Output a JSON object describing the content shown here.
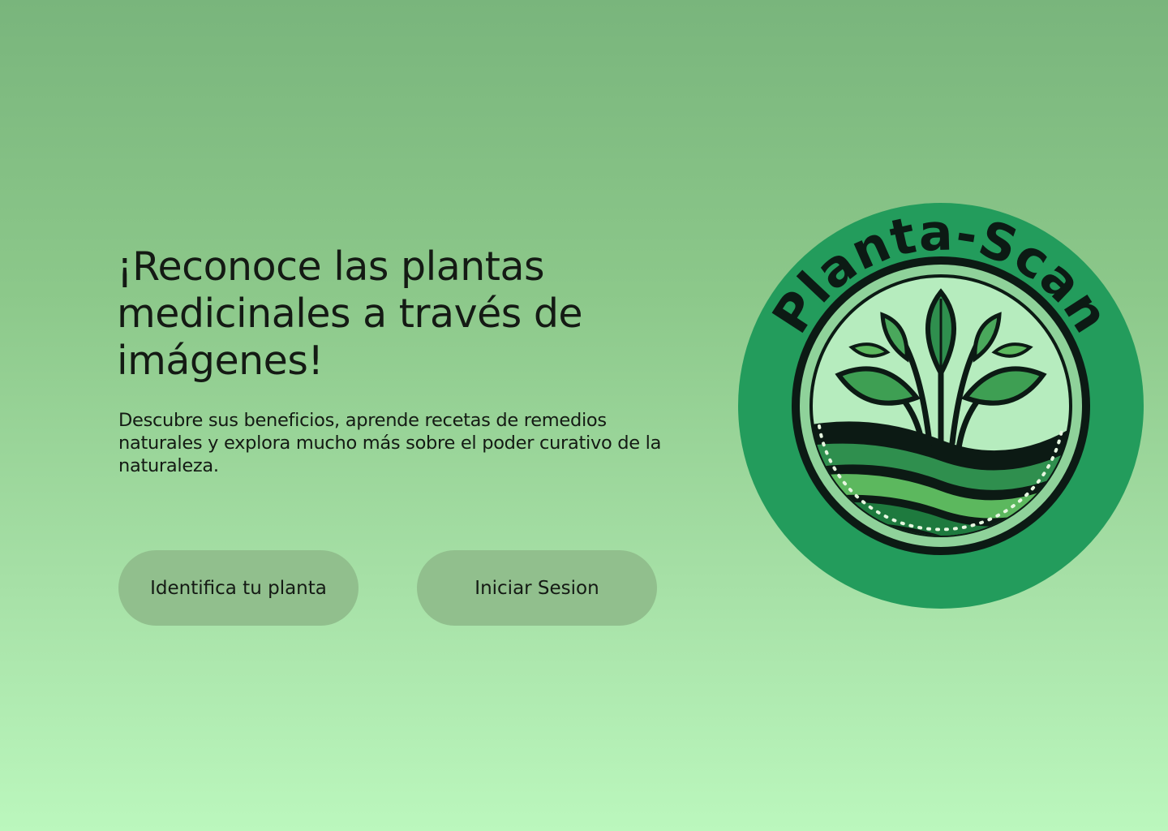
{
  "hero": {
    "title": "¡Reconoce las plantas medicinales a través de imágenes!",
    "description": "Descubre sus beneficios, aprende recetas de remedios naturales y explora mucho más sobre el poder curativo de la naturaleza."
  },
  "actions": {
    "identify_label": "Identifica tu planta",
    "login_label": "Iniciar Sesion"
  },
  "logo": {
    "text": "Planta-Scan",
    "icon": "sprout-logo-icon"
  },
  "colors": {
    "background_top": "#79b57c",
    "background_bottom": "#bbf7bd",
    "button": "#91bf8d",
    "logo_green": "#239c5c",
    "logo_dark": "#0c1a14"
  }
}
